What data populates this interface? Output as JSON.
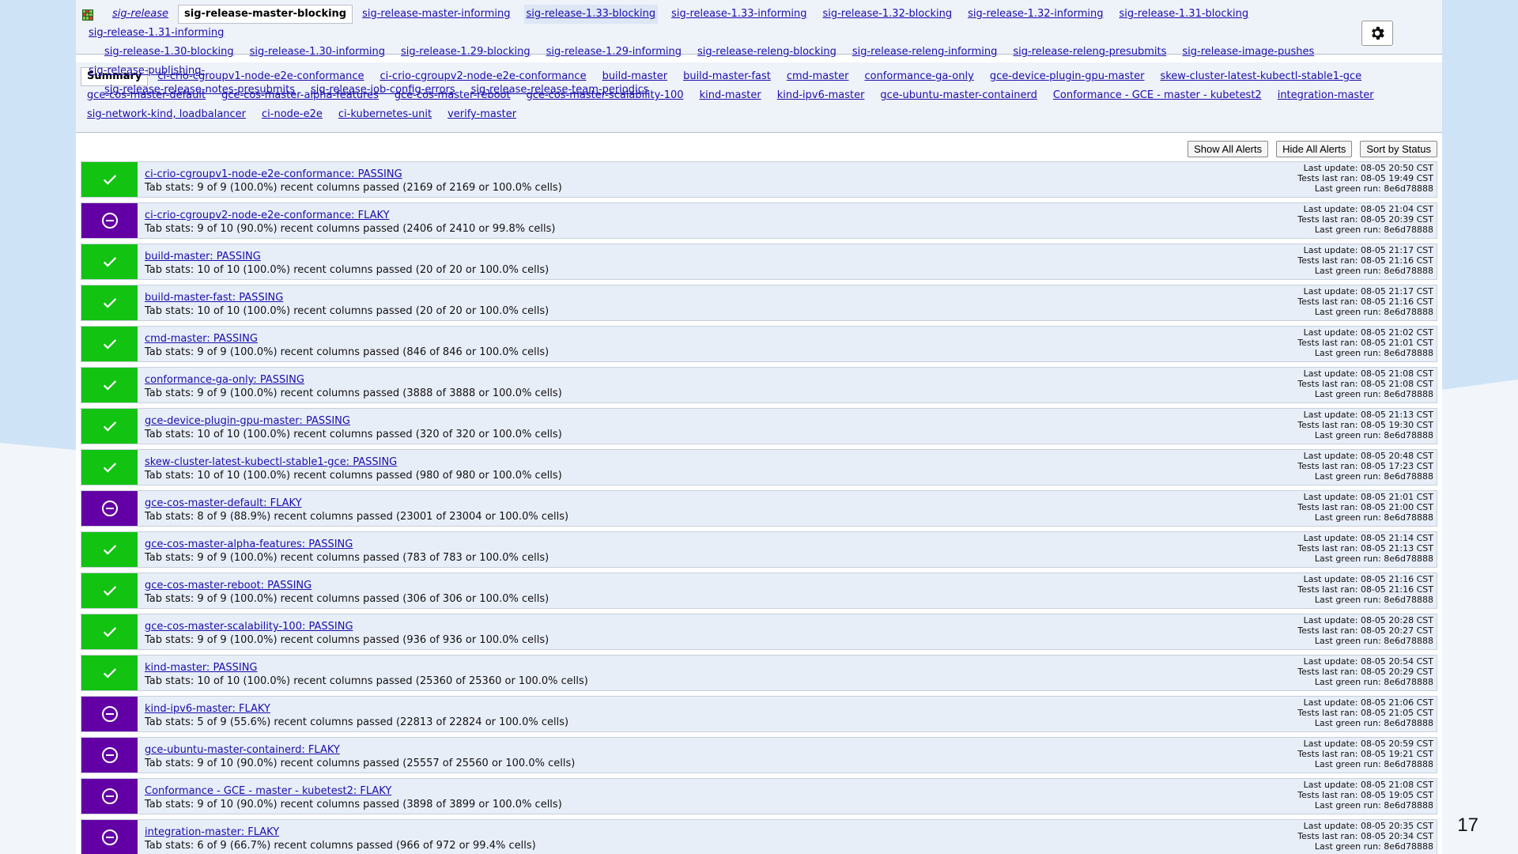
{
  "group_tabs": [
    {
      "label": "sig-release",
      "style": "italic"
    },
    {
      "label": "sig-release-master-blocking",
      "style": "active"
    },
    {
      "label": "sig-release-master-informing"
    },
    {
      "label": "sig-release-1.33-blocking",
      "style": "hover"
    },
    {
      "label": "sig-release-1.33-informing"
    },
    {
      "label": "sig-release-1.32-blocking"
    },
    {
      "label": "sig-release-1.32-informing"
    },
    {
      "label": "sig-release-1.31-blocking"
    },
    {
      "label": "sig-release-1.31-informing"
    },
    {
      "label": "sig-release-1.30-blocking",
      "style": "indent"
    },
    {
      "label": "sig-release-1.30-informing"
    },
    {
      "label": "sig-release-1.29-blocking"
    },
    {
      "label": "sig-release-1.29-informing"
    },
    {
      "label": "sig-release-releng-blocking"
    },
    {
      "label": "sig-release-releng-informing"
    },
    {
      "label": "sig-release-releng-presubmits"
    },
    {
      "label": "sig-release-image-pushes"
    },
    {
      "label": "sig-release-publishing-"
    },
    {
      "label": "sig-release-release-notes-presubmits",
      "style": "indent"
    },
    {
      "label": "sig-release-job-config-errors"
    },
    {
      "label": "sig-release-release-team-periodics"
    }
  ],
  "dashboard_tabs": [
    {
      "label": "Summary",
      "style": "active"
    },
    {
      "label": "ci-crio-cgroupv1-node-e2e-conformance"
    },
    {
      "label": "ci-crio-cgroupv2-node-e2e-conformance"
    },
    {
      "label": "build-master"
    },
    {
      "label": "build-master-fast"
    },
    {
      "label": "cmd-master"
    },
    {
      "label": "conformance-ga-only"
    },
    {
      "label": "gce-device-plugin-gpu-master"
    },
    {
      "label": "skew-cluster-latest-kubectl-stable1-gce"
    },
    {
      "label": "gce-cos-master-default"
    },
    {
      "label": "gce-cos-master-alpha-features"
    },
    {
      "label": "gce-cos-master-reboot"
    },
    {
      "label": "gce-cos-master-scalability-100"
    },
    {
      "label": "kind-master"
    },
    {
      "label": "kind-ipv6-master"
    },
    {
      "label": "gce-ubuntu-master-containerd"
    },
    {
      "label": "Conformance - GCE - master - kubetest2"
    },
    {
      "label": "integration-master"
    },
    {
      "label": "sig-network-kind, loadbalancer"
    },
    {
      "label": "ci-node-e2e"
    },
    {
      "label": "ci-kubernetes-unit"
    },
    {
      "label": "verify-master"
    }
  ],
  "buttons": {
    "show_all_alerts": "Show All Alerts",
    "hide_all_alerts": "Hide All Alerts",
    "sort_by_status": "Sort by Status"
  },
  "icons": {
    "logo": "testgrid-logo-icon",
    "settings": "gear-icon",
    "passing": "checkmark-icon",
    "flaky": "minus-circle-icon"
  },
  "colors": {
    "passing": "#12c312",
    "flaky": "#6300a5",
    "link": "#1a0dab"
  },
  "rows": [
    {
      "name": "ci-crio-cgroupv1-node-e2e-conformance: PASSING",
      "status": "PASSING",
      "stats": "Tab stats: 9 of 9 (100.0%) recent columns passed (2169 of 2169 or 100.0% cells)",
      "last_update": "Last update: 08-05 20:50 CST",
      "tests_last_ran": "Tests last ran: 08-05 19:49 CST",
      "last_green": "Last green run: 8e6d78888"
    },
    {
      "name": "ci-crio-cgroupv2-node-e2e-conformance: FLAKY",
      "status": "FLAKY",
      "stats": "Tab stats: 9 of 10 (90.0%) recent columns passed (2406 of 2410 or 99.8% cells)",
      "last_update": "Last update: 08-05 21:04 CST",
      "tests_last_ran": "Tests last ran: 08-05 20:39 CST",
      "last_green": "Last green run: 8e6d78888"
    },
    {
      "name": "build-master: PASSING",
      "status": "PASSING",
      "stats": "Tab stats: 10 of 10 (100.0%) recent columns passed (20 of 20 or 100.0% cells)",
      "last_update": "Last update: 08-05 21:17 CST",
      "tests_last_ran": "Tests last ran: 08-05 21:16 CST",
      "last_green": "Last green run: 8e6d78888"
    },
    {
      "name": "build-master-fast: PASSING",
      "status": "PASSING",
      "stats": "Tab stats: 10 of 10 (100.0%) recent columns passed (20 of 20 or 100.0% cells)",
      "last_update": "Last update: 08-05 21:17 CST",
      "tests_last_ran": "Tests last ran: 08-05 21:16 CST",
      "last_green": "Last green run: 8e6d78888"
    },
    {
      "name": "cmd-master: PASSING",
      "status": "PASSING",
      "stats": "Tab stats: 9 of 9 (100.0%) recent columns passed (846 of 846 or 100.0% cells)",
      "last_update": "Last update: 08-05 21:02 CST",
      "tests_last_ran": "Tests last ran: 08-05 21:01 CST",
      "last_green": "Last green run: 8e6d78888"
    },
    {
      "name": "conformance-ga-only: PASSING",
      "status": "PASSING",
      "stats": "Tab stats: 9 of 9 (100.0%) recent columns passed (3888 of 3888 or 100.0% cells)",
      "last_update": "Last update: 08-05 21:08 CST",
      "tests_last_ran": "Tests last ran: 08-05 21:08 CST",
      "last_green": "Last green run: 8e6d78888"
    },
    {
      "name": "gce-device-plugin-gpu-master: PASSING",
      "status": "PASSING",
      "stats": "Tab stats: 10 of 10 (100.0%) recent columns passed (320 of 320 or 100.0% cells)",
      "last_update": "Last update: 08-05 21:13 CST",
      "tests_last_ran": "Tests last ran: 08-05 19:30 CST",
      "last_green": "Last green run: 8e6d78888"
    },
    {
      "name": "skew-cluster-latest-kubectl-stable1-gce: PASSING",
      "status": "PASSING",
      "stats": "Tab stats: 10 of 10 (100.0%) recent columns passed (980 of 980 or 100.0% cells)",
      "last_update": "Last update: 08-05 20:48 CST",
      "tests_last_ran": "Tests last ran: 08-05 17:23 CST",
      "last_green": "Last green run: 8e6d78888"
    },
    {
      "name": "gce-cos-master-default: FLAKY",
      "status": "FLAKY",
      "stats": "Tab stats: 8 of 9 (88.9%) recent columns passed (23001 of 23004 or 100.0% cells)",
      "last_update": "Last update: 08-05 21:01 CST",
      "tests_last_ran": "Tests last ran: 08-05 21:00 CST",
      "last_green": "Last green run: 8e6d78888"
    },
    {
      "name": "gce-cos-master-alpha-features: PASSING",
      "status": "PASSING",
      "stats": "Tab stats: 9 of 9 (100.0%) recent columns passed (783 of 783 or 100.0% cells)",
      "last_update": "Last update: 08-05 21:14 CST",
      "tests_last_ran": "Tests last ran: 08-05 21:13 CST",
      "last_green": "Last green run: 8e6d78888"
    },
    {
      "name": "gce-cos-master-reboot: PASSING",
      "status": "PASSING",
      "stats": "Tab stats: 9 of 9 (100.0%) recent columns passed (306 of 306 or 100.0% cells)",
      "last_update": "Last update: 08-05 21:16 CST",
      "tests_last_ran": "Tests last ran: 08-05 21:16 CST",
      "last_green": "Last green run: 8e6d78888"
    },
    {
      "name": "gce-cos-master-scalability-100: PASSING",
      "status": "PASSING",
      "stats": "Tab stats: 9 of 9 (100.0%) recent columns passed (936 of 936 or 100.0% cells)",
      "last_update": "Last update: 08-05 20:28 CST",
      "tests_last_ran": "Tests last ran: 08-05 20:27 CST",
      "last_green": "Last green run: 8e6d78888"
    },
    {
      "name": "kind-master: PASSING",
      "status": "PASSING",
      "stats": "Tab stats: 10 of 10 (100.0%) recent columns passed (25360 of 25360 or 100.0% cells)",
      "last_update": "Last update: 08-05 20:54 CST",
      "tests_last_ran": "Tests last ran: 08-05 20:29 CST",
      "last_green": "Last green run: 8e6d78888"
    },
    {
      "name": "kind-ipv6-master: FLAKY",
      "status": "FLAKY",
      "stats": "Tab stats: 5 of 9 (55.6%) recent columns passed (22813 of 22824 or 100.0% cells)",
      "last_update": "Last update: 08-05 21:06 CST",
      "tests_last_ran": "Tests last ran: 08-05 21:05 CST",
      "last_green": "Last green run: 8e6d78888"
    },
    {
      "name": "gce-ubuntu-master-containerd: FLAKY",
      "status": "FLAKY",
      "stats": "Tab stats: 9 of 10 (90.0%) recent columns passed (25557 of 25560 or 100.0% cells)",
      "last_update": "Last update: 08-05 20:59 CST",
      "tests_last_ran": "Tests last ran: 08-05 19:21 CST",
      "last_green": "Last green run: 8e6d78888"
    },
    {
      "name": "Conformance - GCE - master - kubetest2: FLAKY",
      "status": "FLAKY",
      "stats": "Tab stats: 9 of 10 (90.0%) recent columns passed (3898 of 3899 or 100.0% cells)",
      "last_update": "Last update: 08-05 21:08 CST",
      "tests_last_ran": "Tests last ran: 08-05 19:05 CST",
      "last_green": "Last green run: 8e6d78888"
    },
    {
      "name": "integration-master: FLAKY",
      "status": "FLAKY",
      "stats": "Tab stats: 6 of 9 (66.7%) recent columns passed (966 of 972 or 99.4% cells)",
      "last_update": "Last update: 08-05 20:35 CST",
      "tests_last_ran": "Tests last ran: 08-05 20:34 CST",
      "last_green": "Last green run: 8e6d78888"
    }
  ],
  "slide_number": "17"
}
